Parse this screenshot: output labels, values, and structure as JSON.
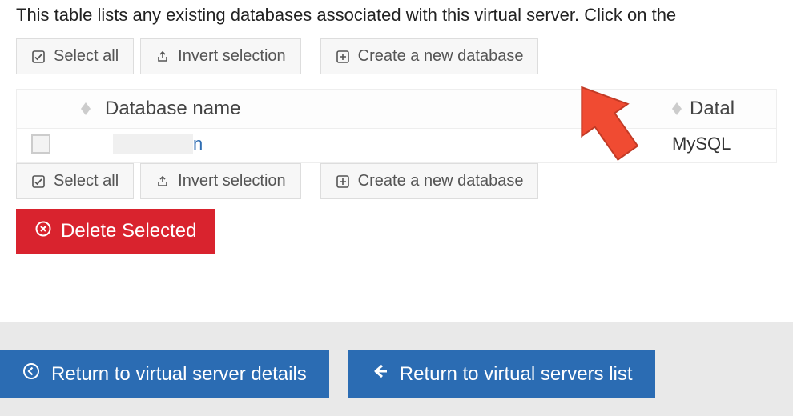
{
  "intro_text": "This table lists any existing databases associated with this virtual server. Click on the",
  "toolbar": {
    "select_all": "Select all",
    "invert_selection": "Invert selection",
    "create_db": "Create a new database"
  },
  "table": {
    "headers": {
      "name": "Database name",
      "type": "Datal"
    },
    "rows": [
      {
        "name_fragment": "n",
        "type": "MySQL"
      }
    ]
  },
  "delete_label": "Delete Selected",
  "footer": {
    "return_details": "Return to virtual server details",
    "return_list": "Return to virtual servers list"
  }
}
